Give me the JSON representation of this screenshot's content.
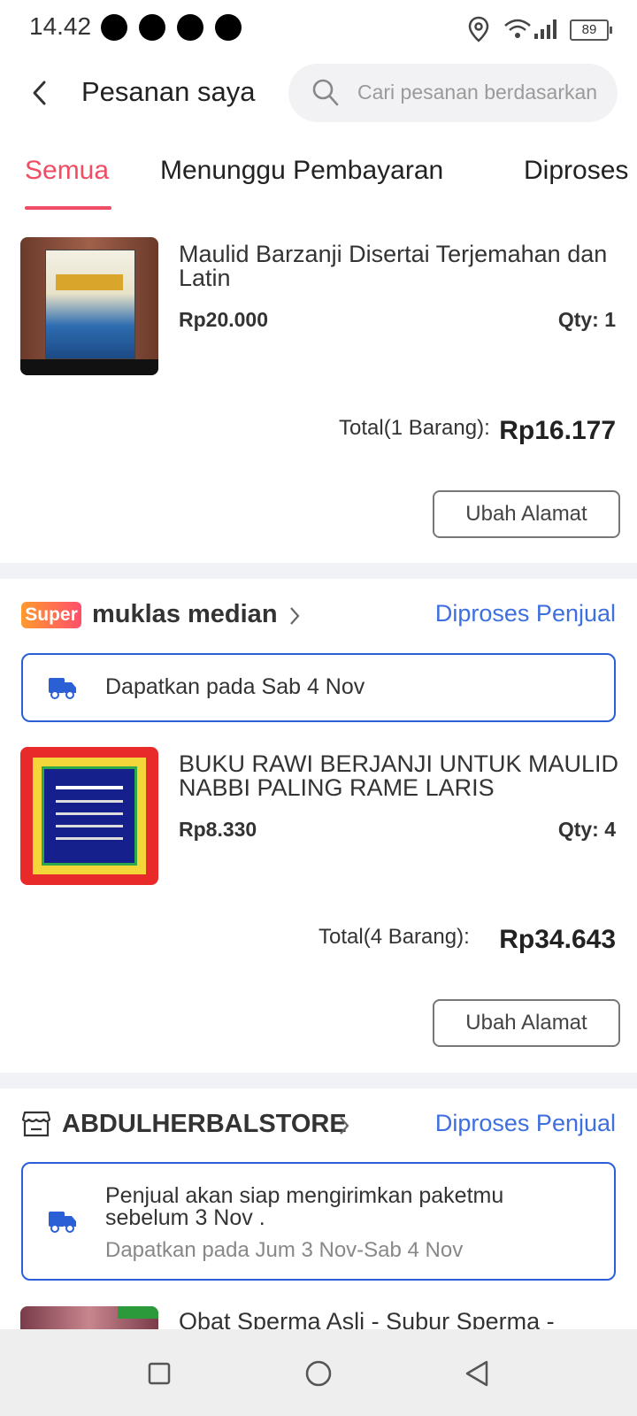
{
  "status_bar": {
    "time": "14.42",
    "battery": "89"
  },
  "header": {
    "title": "Pesanan saya",
    "search_placeholder": "Cari pesanan berdasarkan"
  },
  "tabs": [
    {
      "label": "Semua",
      "active": true
    },
    {
      "label": "Menunggu Pembayaran",
      "active": false
    },
    {
      "label": "Diproses",
      "active": false
    }
  ],
  "orders": [
    {
      "product": {
        "name": "Maulid Barzanji Disertai Terjemahan dan Latin",
        "price": "Rp20.000",
        "qty": "Qty: 1"
      },
      "total_label": "Total(1 Barang):",
      "total_value": "Rp16.177",
      "action": "Ubah Alamat"
    },
    {
      "badge": "Super",
      "shop": "muklas median",
      "status": "Diproses Penjual",
      "delivery": "Dapatkan pada Sab 4 Nov",
      "product": {
        "name": "BUKU RAWI BERJANJI UNTUK MAULID NABBI PALING RAME LARIS",
        "price": "Rp8.330",
        "qty": "Qty: 4"
      },
      "total_label": "Total(4 Barang):",
      "total_value": "Rp34.643",
      "action": "Ubah Alamat"
    },
    {
      "shop": "ABDULHERBALSTORE",
      "status": "Diproses Penjual",
      "delivery_main": "Penjual akan siap mengirimkan paketmu sebelum 3 Nov .",
      "delivery_sub": "Dapatkan pada Jum 3 Nov-Sab 4 Nov",
      "product": {
        "name": "Obat Sperma Asli - Subur Sperma -"
      }
    }
  ],
  "colors": {
    "accent": "#ee4d64",
    "link": "#3d6fe0",
    "box_border": "#2a5fd6"
  }
}
